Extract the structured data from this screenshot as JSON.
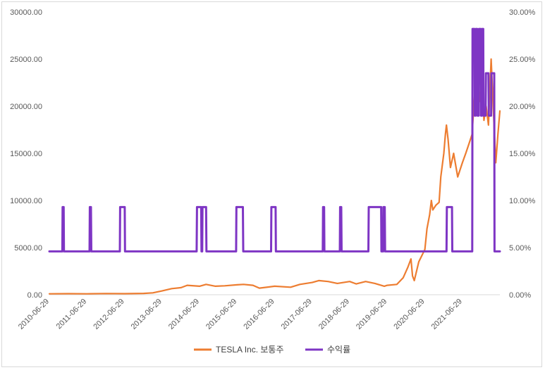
{
  "chart_data": {
    "type": "line",
    "title": "",
    "x_ticks": [
      "2010-06-29",
      "2011-06-29",
      "2012-06-29",
      "2013-06-29",
      "2014-06-29",
      "2015-06-29",
      "2016-06-29",
      "2017-06-29",
      "2018-06-29",
      "2019-06-29",
      "2020-06-29",
      "2021-06-29"
    ],
    "xlim": [
      "2010-06-29",
      "2022-06-29"
    ],
    "left_axis": {
      "ylim": [
        0,
        30000
      ],
      "ticks": [
        "0.00",
        "5000.00",
        "10000.00",
        "15000.00",
        "20000.00",
        "25000.00",
        "30000.00"
      ]
    },
    "right_axis": {
      "ylim": [
        0,
        0.3
      ],
      "ticks": [
        "0.00%",
        "5.00%",
        "10.00%",
        "15.00%",
        "20.00%",
        "25.00%",
        "30.00%"
      ]
    },
    "grid": false,
    "legend_position": "bottom",
    "series": [
      {
        "name": "TESLA Inc. 보통주",
        "axis": "left",
        "color": "#ed7d31",
        "points": [
          [
            "2010-06-29",
            100
          ],
          [
            "2011-01-01",
            110
          ],
          [
            "2011-06-29",
            100
          ],
          [
            "2012-01-01",
            130
          ],
          [
            "2012-06-29",
            110
          ],
          [
            "2013-01-01",
            140
          ],
          [
            "2013-04-01",
            200
          ],
          [
            "2013-06-29",
            400
          ],
          [
            "2013-10-01",
            650
          ],
          [
            "2014-01-01",
            750
          ],
          [
            "2014-03-01",
            1000
          ],
          [
            "2014-06-29",
            900
          ],
          [
            "2014-09-01",
            1100
          ],
          [
            "2014-12-01",
            900
          ],
          [
            "2015-03-01",
            950
          ],
          [
            "2015-06-29",
            1050
          ],
          [
            "2015-09-01",
            1100
          ],
          [
            "2015-12-01",
            1000
          ],
          [
            "2016-02-01",
            700
          ],
          [
            "2016-06-29",
            900
          ],
          [
            "2016-12-01",
            800
          ],
          [
            "2017-03-01",
            1100
          ],
          [
            "2017-06-29",
            1300
          ],
          [
            "2017-09-01",
            1500
          ],
          [
            "2017-12-01",
            1400
          ],
          [
            "2018-03-01",
            1200
          ],
          [
            "2018-06-29",
            1400
          ],
          [
            "2018-09-01",
            1150
          ],
          [
            "2018-12-01",
            1400
          ],
          [
            "2019-03-01",
            1200
          ],
          [
            "2019-06-01",
            900
          ],
          [
            "2019-06-29",
            1000
          ],
          [
            "2019-10-01",
            1100
          ],
          [
            "2019-12-01",
            1800
          ],
          [
            "2020-01-15",
            2900
          ],
          [
            "2020-02-15",
            3800
          ],
          [
            "2020-03-01",
            2000
          ],
          [
            "2020-03-18",
            1500
          ],
          [
            "2020-05-01",
            3500
          ],
          [
            "2020-06-29",
            4800
          ],
          [
            "2020-07-20",
            7000
          ],
          [
            "2020-08-15",
            8500
          ],
          [
            "2020-08-31",
            10000
          ],
          [
            "2020-09-15",
            9000
          ],
          [
            "2020-10-15",
            9500
          ],
          [
            "2020-11-15",
            9800
          ],
          [
            "2020-12-01",
            12500
          ],
          [
            "2020-12-31",
            15000
          ],
          [
            "2021-01-15",
            17000
          ],
          [
            "2021-01-25",
            18000
          ],
          [
            "2021-02-10",
            16500
          ],
          [
            "2021-03-05",
            13500
          ],
          [
            "2021-04-05",
            15000
          ],
          [
            "2021-05-15",
            12500
          ],
          [
            "2021-06-29",
            14000
          ],
          [
            "2021-08-01",
            15000
          ],
          [
            "2021-09-01",
            16000
          ],
          [
            "2021-10-01",
            17000
          ],
          [
            "2021-10-25",
            21000
          ],
          [
            "2021-11-05",
            24000
          ],
          [
            "2021-11-20",
            21000
          ],
          [
            "2021-12-15",
            20500
          ],
          [
            "2022-01-05",
            23000
          ],
          [
            "2022-01-25",
            18500
          ],
          [
            "2022-02-15",
            20000
          ],
          [
            "2022-03-10",
            18000
          ],
          [
            "2022-04-05",
            25000
          ],
          [
            "2022-04-25",
            20000
          ],
          [
            "2022-05-20",
            14000
          ],
          [
            "2022-06-10",
            17000
          ],
          [
            "2022-06-29",
            19500
          ]
        ]
      },
      {
        "name": "수익률",
        "axis": "right",
        "color": "#7e35c4",
        "points": [
          [
            "2010-06-29",
            0.046
          ],
          [
            "2010-11-02",
            0.046
          ],
          [
            "2010-11-05",
            0.093
          ],
          [
            "2010-11-15",
            0.093
          ],
          [
            "2010-11-18",
            0.046
          ],
          [
            "2011-07-25",
            0.046
          ],
          [
            "2011-07-28",
            0.093
          ],
          [
            "2011-08-08",
            0.093
          ],
          [
            "2011-08-11",
            0.046
          ],
          [
            "2012-05-15",
            0.046
          ],
          [
            "2012-05-18",
            0.093
          ],
          [
            "2012-07-01",
            0.093
          ],
          [
            "2012-07-04",
            0.046
          ],
          [
            "2014-06-01",
            0.046
          ],
          [
            "2014-06-04",
            0.093
          ],
          [
            "2014-07-15",
            0.093
          ],
          [
            "2014-07-18",
            0.046
          ],
          [
            "2014-07-25",
            0.046
          ],
          [
            "2014-07-28",
            0.093
          ],
          [
            "2014-09-01",
            0.093
          ],
          [
            "2014-09-04",
            0.046
          ],
          [
            "2015-06-20",
            0.046
          ],
          [
            "2015-06-23",
            0.093
          ],
          [
            "2015-08-25",
            0.093
          ],
          [
            "2015-08-28",
            0.046
          ],
          [
            "2016-05-25",
            0.046
          ],
          [
            "2016-05-28",
            0.093
          ],
          [
            "2016-07-08",
            0.093
          ],
          [
            "2016-07-11",
            0.046
          ],
          [
            "2017-10-10",
            0.046
          ],
          [
            "2017-10-13",
            0.093
          ],
          [
            "2017-10-23",
            0.093
          ],
          [
            "2017-10-26",
            0.046
          ],
          [
            "2018-03-25",
            0.046
          ],
          [
            "2018-03-28",
            0.093
          ],
          [
            "2018-04-08",
            0.093
          ],
          [
            "2018-04-11",
            0.046
          ],
          [
            "2018-12-28",
            0.046
          ],
          [
            "2018-12-31",
            0.093
          ],
          [
            "2019-05-01",
            0.093
          ],
          [
            "2019-05-04",
            0.046
          ],
          [
            "2019-05-20",
            0.046
          ],
          [
            "2019-05-23",
            0.093
          ],
          [
            "2019-06-05",
            0.093
          ],
          [
            "2019-06-08",
            0.046
          ],
          [
            "2021-01-26",
            0.046
          ],
          [
            "2021-01-29",
            0.093
          ],
          [
            "2021-03-20",
            0.093
          ],
          [
            "2021-03-23",
            0.046
          ],
          [
            "2021-10-03",
            0.046
          ],
          [
            "2021-10-06",
            0.282
          ],
          [
            "2021-10-25",
            0.282
          ],
          [
            "2021-10-28",
            0.19
          ],
          [
            "2021-11-05",
            0.19
          ],
          [
            "2021-11-08",
            0.282
          ],
          [
            "2021-11-20",
            0.282
          ],
          [
            "2021-11-23",
            0.19
          ],
          [
            "2021-12-05",
            0.19
          ],
          [
            "2021-12-08",
            0.282
          ],
          [
            "2021-12-25",
            0.282
          ],
          [
            "2021-12-28",
            0.19
          ],
          [
            "2022-01-05",
            0.19
          ],
          [
            "2022-01-08",
            0.282
          ],
          [
            "2022-01-18",
            0.282
          ],
          [
            "2022-01-21",
            0.19
          ],
          [
            "2022-02-10",
            0.19
          ],
          [
            "2022-02-13",
            0.235
          ],
          [
            "2022-03-10",
            0.235
          ],
          [
            "2022-03-13",
            0.19
          ],
          [
            "2022-04-05",
            0.19
          ],
          [
            "2022-04-08",
            0.235
          ],
          [
            "2022-05-05",
            0.235
          ],
          [
            "2022-05-08",
            0.046
          ],
          [
            "2022-06-29",
            0.046
          ]
        ]
      }
    ]
  }
}
